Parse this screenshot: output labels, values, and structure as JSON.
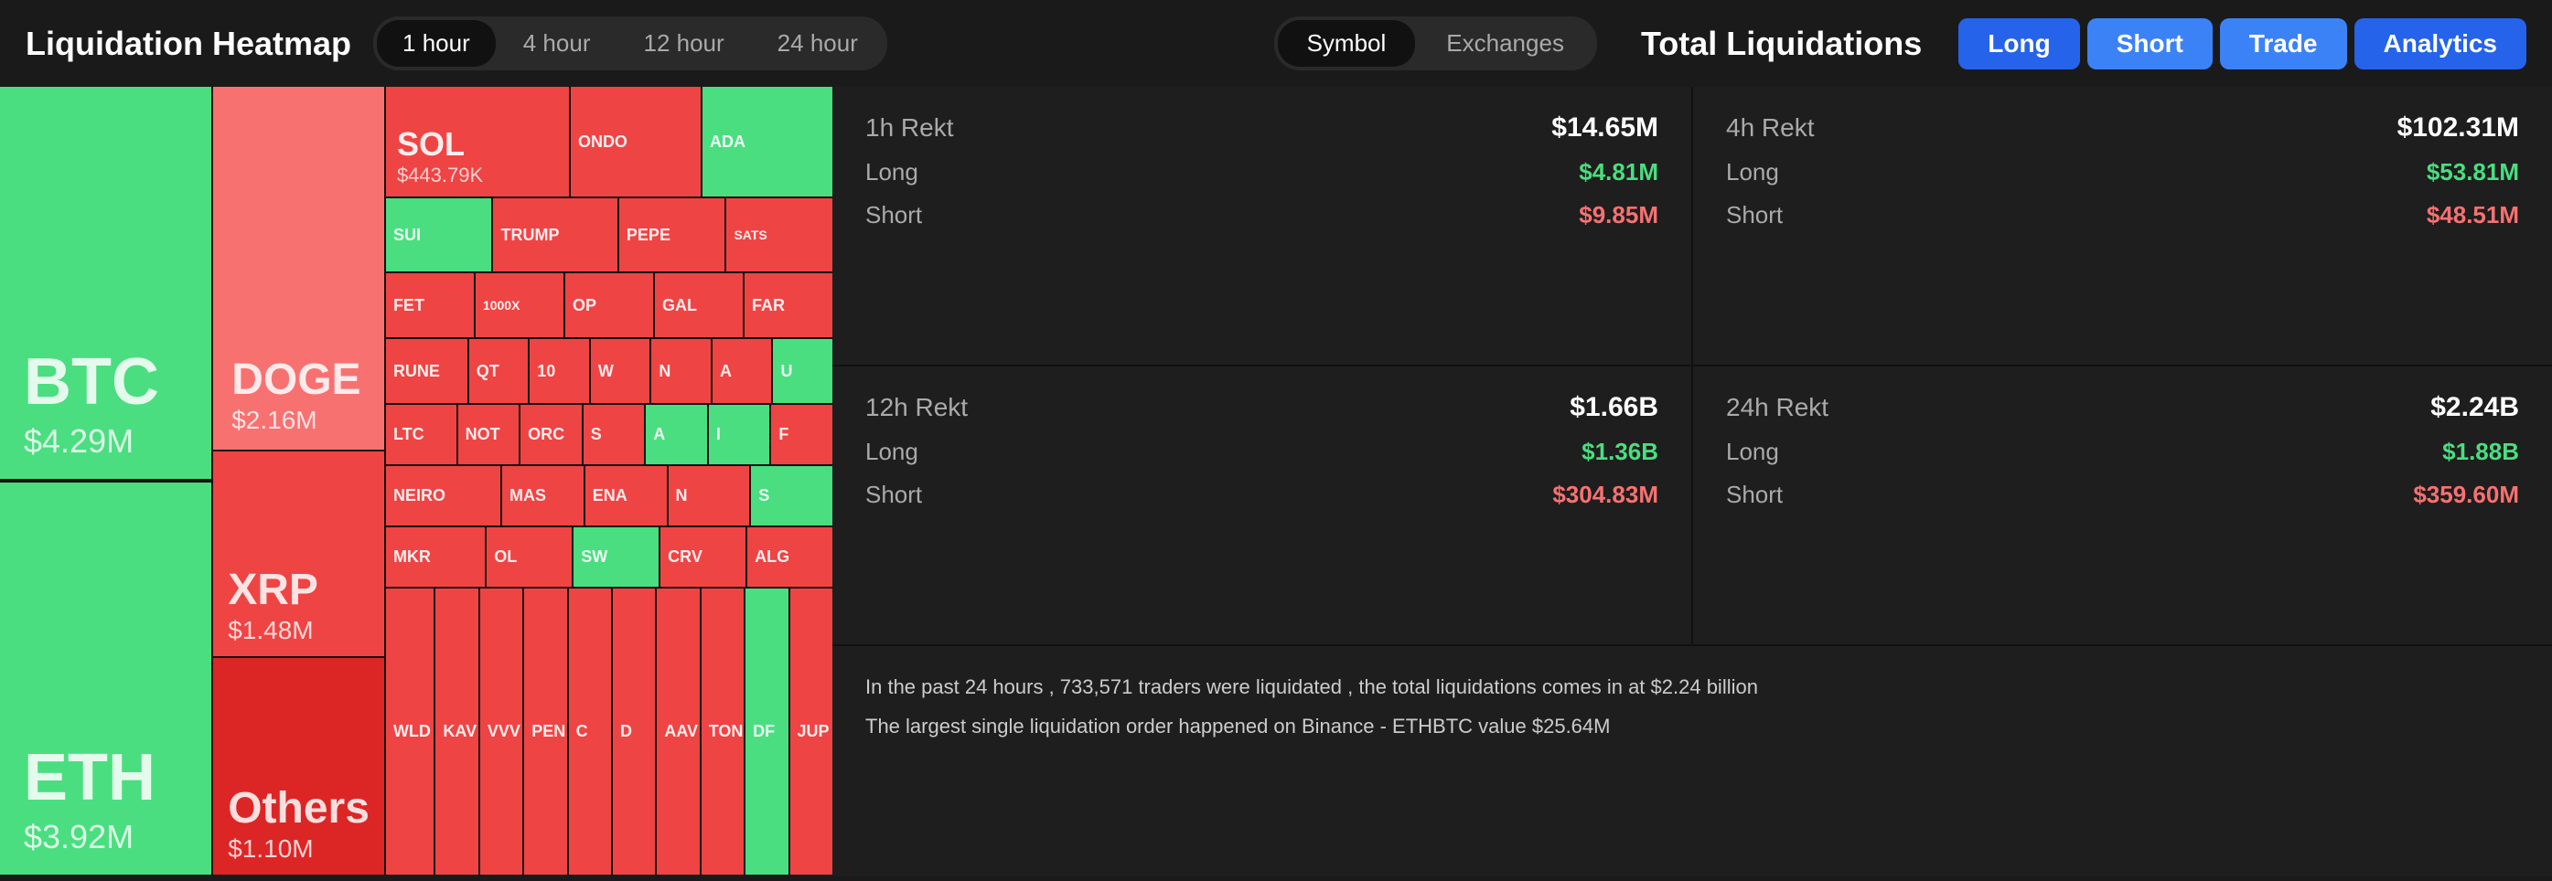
{
  "header": {
    "logo": "Liquidation Heatmap",
    "time_tabs": [
      {
        "label": "1 hour",
        "active": true
      },
      {
        "label": "4 hour",
        "active": false
      },
      {
        "label": "12 hour",
        "active": false
      },
      {
        "label": "24 hour",
        "active": false
      }
    ],
    "filter_tabs": [
      {
        "label": "Symbol",
        "active": false
      },
      {
        "label": "Exchanges",
        "active": false
      }
    ],
    "total_liquidations_title": "Total Liquidations",
    "action_buttons": [
      {
        "label": "Long",
        "class": "btn-long"
      },
      {
        "label": "Short",
        "class": "btn-short"
      },
      {
        "label": "Trade",
        "class": "btn-trade"
      },
      {
        "label": "Analytics",
        "class": "btn-analytics"
      }
    ]
  },
  "heatmap": {
    "tiles": [
      {
        "symbol": "BTC",
        "value": "$4.29M",
        "color": "green",
        "size": "large"
      },
      {
        "symbol": "ETH",
        "value": "$3.92M",
        "color": "green",
        "size": "large"
      },
      {
        "symbol": "DOGE",
        "value": "$2.16M",
        "color": "red",
        "size": "medium"
      },
      {
        "symbol": "XRP",
        "value": "$1.48M",
        "color": "dark-red",
        "size": "medium"
      },
      {
        "symbol": "Others",
        "value": "$1.10M",
        "color": "dark-red",
        "size": "medium"
      },
      {
        "symbol": "SOL",
        "value": "$443.79K",
        "color": "red",
        "size": "small"
      },
      {
        "symbol": "ONDO",
        "value": "",
        "color": "red",
        "size": "tiny"
      },
      {
        "symbol": "ADA",
        "value": "",
        "color": "green",
        "size": "tiny"
      },
      {
        "symbol": "SUI",
        "value": "",
        "color": "green",
        "size": "tiny"
      },
      {
        "symbol": "TRUMP",
        "value": "",
        "color": "red",
        "size": "tiny"
      },
      {
        "symbol": "PEPE",
        "value": "",
        "color": "red",
        "size": "tiny"
      },
      {
        "symbol": "SATS",
        "value": "",
        "color": "red",
        "size": "tiny"
      },
      {
        "symbol": "FET",
        "value": "",
        "color": "red",
        "size": "tiny"
      },
      {
        "symbol": "1000X",
        "value": "",
        "color": "red",
        "size": "tiny"
      },
      {
        "symbol": "OP",
        "value": "",
        "color": "red",
        "size": "tiny"
      },
      {
        "symbol": "GAL",
        "value": "",
        "color": "red",
        "size": "tiny"
      },
      {
        "symbol": "FAR",
        "value": "",
        "color": "red",
        "size": "tiny"
      },
      {
        "symbol": "RUNE",
        "value": "",
        "color": "red",
        "size": "tiny"
      },
      {
        "symbol": "QT",
        "value": "",
        "color": "red",
        "size": "tiny"
      },
      {
        "symbol": "10",
        "value": "",
        "color": "red",
        "size": "tiny"
      },
      {
        "symbol": "W",
        "value": "",
        "color": "red",
        "size": "tiny"
      },
      {
        "symbol": "N",
        "value": "",
        "color": "red",
        "size": "tiny"
      },
      {
        "symbol": "A",
        "value": "",
        "color": "red",
        "size": "tiny"
      },
      {
        "symbol": "U",
        "value": "",
        "color": "green",
        "size": "tiny"
      },
      {
        "symbol": "LTC",
        "value": "",
        "color": "red",
        "size": "tiny"
      },
      {
        "symbol": "NOT",
        "value": "",
        "color": "red",
        "size": "tiny"
      },
      {
        "symbol": "ORC",
        "value": "",
        "color": "red",
        "size": "tiny"
      },
      {
        "symbol": "S",
        "value": "",
        "color": "red",
        "size": "tiny"
      },
      {
        "symbol": "A",
        "value": "",
        "color": "green",
        "size": "tiny"
      },
      {
        "symbol": "I",
        "value": "",
        "color": "green",
        "size": "tiny"
      },
      {
        "symbol": "F",
        "value": "",
        "color": "red",
        "size": "tiny"
      },
      {
        "symbol": "NEIRO",
        "value": "",
        "color": "red",
        "size": "tiny"
      },
      {
        "symbol": "MAS",
        "value": "",
        "color": "red",
        "size": "tiny"
      },
      {
        "symbol": "ENA",
        "value": "",
        "color": "red",
        "size": "tiny"
      },
      {
        "symbol": "N",
        "value": "",
        "color": "red",
        "size": "tiny"
      },
      {
        "symbol": "S",
        "value": "",
        "color": "green",
        "size": "tiny"
      },
      {
        "symbol": "MKR",
        "value": "",
        "color": "red",
        "size": "tiny"
      },
      {
        "symbol": "OL",
        "value": "",
        "color": "red",
        "size": "tiny"
      },
      {
        "symbol": "SW",
        "value": "",
        "color": "green",
        "size": "tiny"
      },
      {
        "symbol": "CRV",
        "value": "",
        "color": "red",
        "size": "tiny"
      },
      {
        "symbol": "ALG",
        "value": "",
        "color": "red",
        "size": "tiny"
      },
      {
        "symbol": "WLD",
        "value": "",
        "color": "red",
        "size": "tiny"
      },
      {
        "symbol": "KAV",
        "value": "",
        "color": "red",
        "size": "tiny"
      },
      {
        "symbol": "VVV",
        "value": "",
        "color": "red",
        "size": "tiny"
      },
      {
        "symbol": "PEN",
        "value": "",
        "color": "red",
        "size": "tiny"
      },
      {
        "symbol": "C",
        "value": "",
        "color": "red",
        "size": "tiny"
      },
      {
        "symbol": "D",
        "value": "",
        "color": "red",
        "size": "tiny"
      },
      {
        "symbol": "AAV",
        "value": "",
        "color": "red",
        "size": "tiny"
      },
      {
        "symbol": "TON",
        "value": "",
        "color": "red",
        "size": "tiny"
      },
      {
        "symbol": "DF",
        "value": "",
        "color": "green",
        "size": "tiny"
      },
      {
        "symbol": "JUP",
        "value": "",
        "color": "red",
        "size": "tiny"
      }
    ]
  },
  "stats": {
    "1h": {
      "title": "1h Rekt",
      "total": "$14.65M",
      "long": "$4.81M",
      "short": "$9.85M"
    },
    "4h": {
      "title": "4h Rekt",
      "total": "$102.31M",
      "long": "$53.81M",
      "short": "$48.51M"
    },
    "12h": {
      "title": "12h Rekt",
      "total": "$1.66B",
      "long": "$1.36B",
      "short": "$304.83M"
    },
    "24h": {
      "title": "24h Rekt",
      "total": "$2.24B",
      "long": "$1.88B",
      "short": "$359.60M"
    },
    "info": {
      "line1": "In the past 24 hours , 733,571 traders were liquidated , the total liquidations comes in at $2.24 billion",
      "line2": "The largest single liquidation order happened on Binance - ETHBTC value $25.64M"
    },
    "labels": {
      "long": "Long",
      "short": "Short"
    }
  }
}
